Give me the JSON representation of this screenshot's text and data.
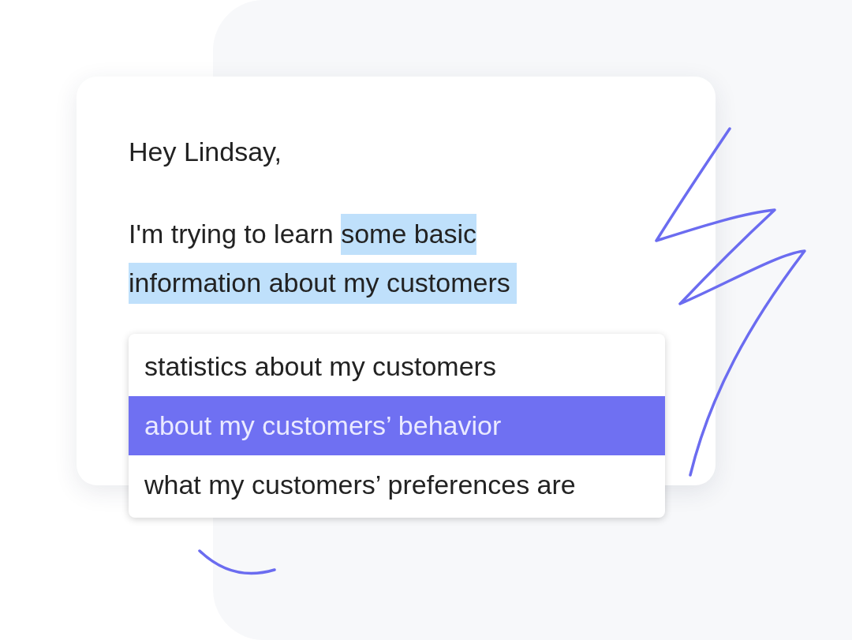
{
  "email": {
    "greeting": "Hey Lindsay,",
    "sentence": {
      "before": "I'm trying to learn ",
      "highlighted": "some basic information about my customers"
    }
  },
  "suggestions": [
    {
      "text": "statistics about my customers",
      "selected": false
    },
    {
      "text": "about my customers’ behavior",
      "selected": true
    },
    {
      "text": "what my customers’ preferences are",
      "selected": false
    }
  ]
}
